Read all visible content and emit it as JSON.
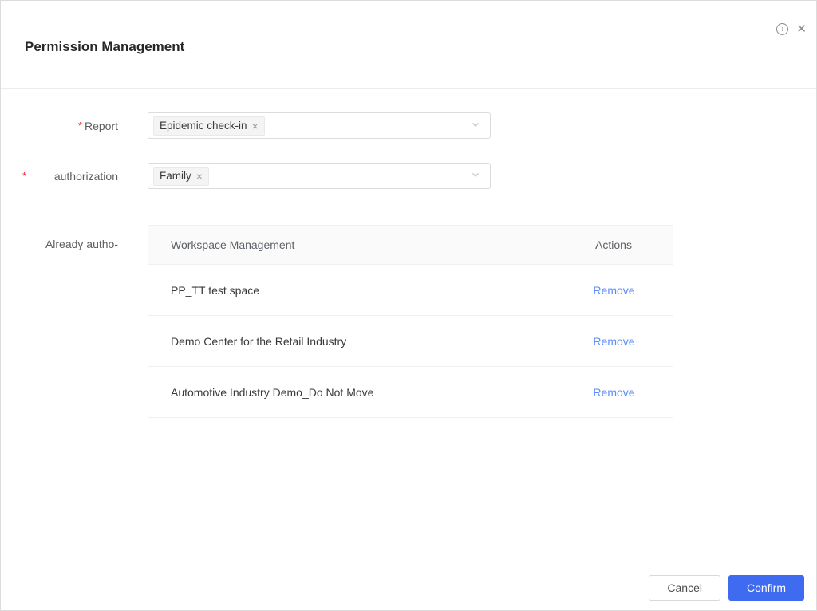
{
  "page": {
    "title": "Permission Management"
  },
  "icons": {
    "info": "i",
    "close": "✕",
    "tag_close": "×"
  },
  "form": {
    "rows": [
      {
        "label": "Report",
        "required": "*",
        "tag": "Epidemic check-in"
      },
      {
        "label": "authorization",
        "required": "*",
        "tag": "Family"
      },
      {
        "label": "Already autho-"
      }
    ]
  },
  "table": {
    "headers": [
      "Workspace Management",
      "Actions"
    ],
    "rows": [
      {
        "name": "PP_TT test space",
        "action": "Remove"
      },
      {
        "name": "Demo Center for the Retail Industry",
        "action": "Remove"
      },
      {
        "name": "Automotive Industry Demo_Do Not Move",
        "action": "Remove"
      }
    ]
  },
  "footer": {
    "cancel_label": "Cancel",
    "confirm_label": "Confirm"
  },
  "colors": {
    "primary": "#3e6bf0",
    "link": "#5a8cf8",
    "required": "#f5222d"
  }
}
